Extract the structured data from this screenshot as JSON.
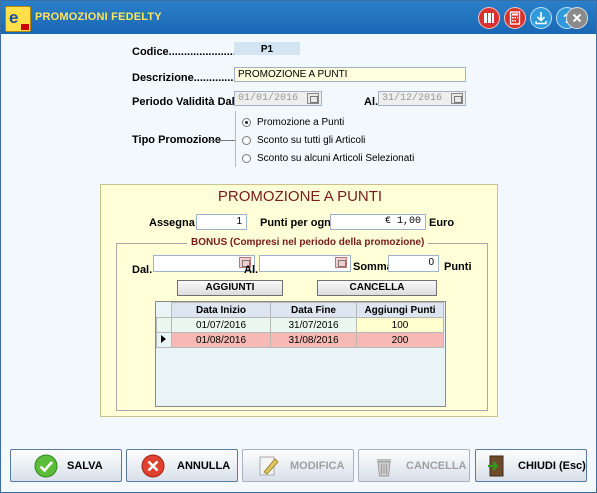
{
  "window": {
    "title": "PROMOZIONI FEDELTY",
    "title_color": "#ffe45c",
    "titlebar_color": "#1f72bf",
    "titlebar_buttons": [
      {
        "name": "archive-icon",
        "color": "#d9322e"
      },
      {
        "name": "calculator-icon",
        "color": "#d9322e"
      },
      {
        "name": "download-icon",
        "color": "#2e9ad9"
      },
      {
        "name": "help-icon",
        "color": "#2e9ad9"
      },
      {
        "name": "close-icon",
        "color": "#8a8a8a"
      }
    ]
  },
  "form": {
    "codice_label": "Codice......................",
    "codice_value": "P1",
    "descrizione_label": "Descrizione.................",
    "descrizione_value": "PROMOZIONE A PUNTI",
    "periodo_label": "Periodo Validità Dal.......",
    "periodo_dal": "01/01/2016",
    "al_label": "Al.",
    "periodo_al": "31/12/2016",
    "tipo_label": "Tipo Promozione",
    "tipo_options": [
      {
        "label": "Promozione a Punti",
        "selected": true
      },
      {
        "label": "Sconto su tutti gli Articoli",
        "selected": false
      },
      {
        "label": "Sconto su alcuni Articoli Selezionati",
        "selected": false
      }
    ]
  },
  "panel": {
    "title": "PROMOZIONE A PUNTI",
    "assegna_label": "Assegna",
    "assegna_value": "1",
    "punti_per_ogni_label": "Punti per ogni",
    "punti_per_ogni_value": "€ 1,00",
    "euro_label": "Euro",
    "bonus_title": "BONUS (Compresi nel periodo della promozione)",
    "dal_label": "Dal.",
    "dal_value": "",
    "al_label": "Al.",
    "al_value": "",
    "somma_label": "Somma",
    "somma_value": "0",
    "punti_label": "Punti",
    "aggiungi_button": "AGGIUNTI",
    "cancella_button": "CANCELLA",
    "table": {
      "headers": [
        "Data Inizio",
        "Data Fine",
        "Aggiungi Punti"
      ],
      "rows": [
        {
          "start": "01/07/2016",
          "end": "31/07/2016",
          "points": "100",
          "current": false
        },
        {
          "start": "01/08/2016",
          "end": "31/08/2016",
          "points": "200",
          "current": true
        }
      ]
    }
  },
  "footer": {
    "salva": "SALVA",
    "annulla": "ANNULLA",
    "modifica": "MODIFICA",
    "cancella": "CANCELLA",
    "chiudi": "CHIUDI (Esc)"
  }
}
